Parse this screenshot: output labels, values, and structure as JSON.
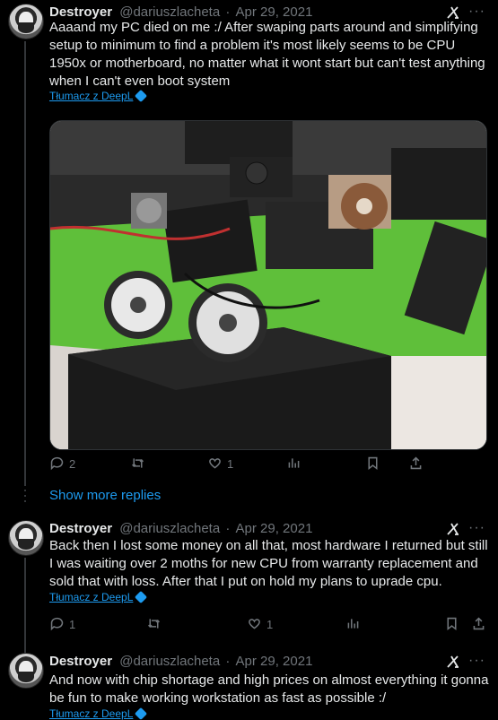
{
  "tweets": [
    {
      "name": "Destroyer",
      "handle": "@dariuszlacheta",
      "date": "Apr 29, 2021",
      "text": "Aaaand my PC died on me :/ After swaping parts around and simplifying setup to minimum to find a problem it's most likely seems to be CPU 1950x or motherboard, no matter what it wont start but can't test anything when I can't even boot system",
      "translate": "Tłumacz z DeepL",
      "replies": "2",
      "reposts": "",
      "likes": "1"
    },
    {
      "name": "Destroyer",
      "handle": "@dariuszlacheta",
      "date": "Apr 29, 2021",
      "text": "Back then I lost some money on all that, most hardware I returned but still I was waiting over 2 moths for new CPU from warranty replacement and sold that with loss. After that I put on hold my plans to uprade cpu.",
      "translate": "Tłumacz z DeepL",
      "replies": "1",
      "reposts": "",
      "likes": "1"
    },
    {
      "name": "Destroyer",
      "handle": "@dariuszlacheta",
      "date": "Apr 29, 2021",
      "text": "And now with chip shortage and high prices on almost everything it gonna be fun to make working workstation as fast as possible :/",
      "translate": "Tłumacz z DeepL"
    }
  ],
  "show_more_replies": "Show more replies",
  "separator": "·",
  "more_icon": "more-horizontal-icon",
  "grok_icon": "grok-icon",
  "colors": {
    "accent": "#1d9bf0",
    "muted": "#71767b",
    "text": "#e7e9ea",
    "bg": "#000000"
  }
}
